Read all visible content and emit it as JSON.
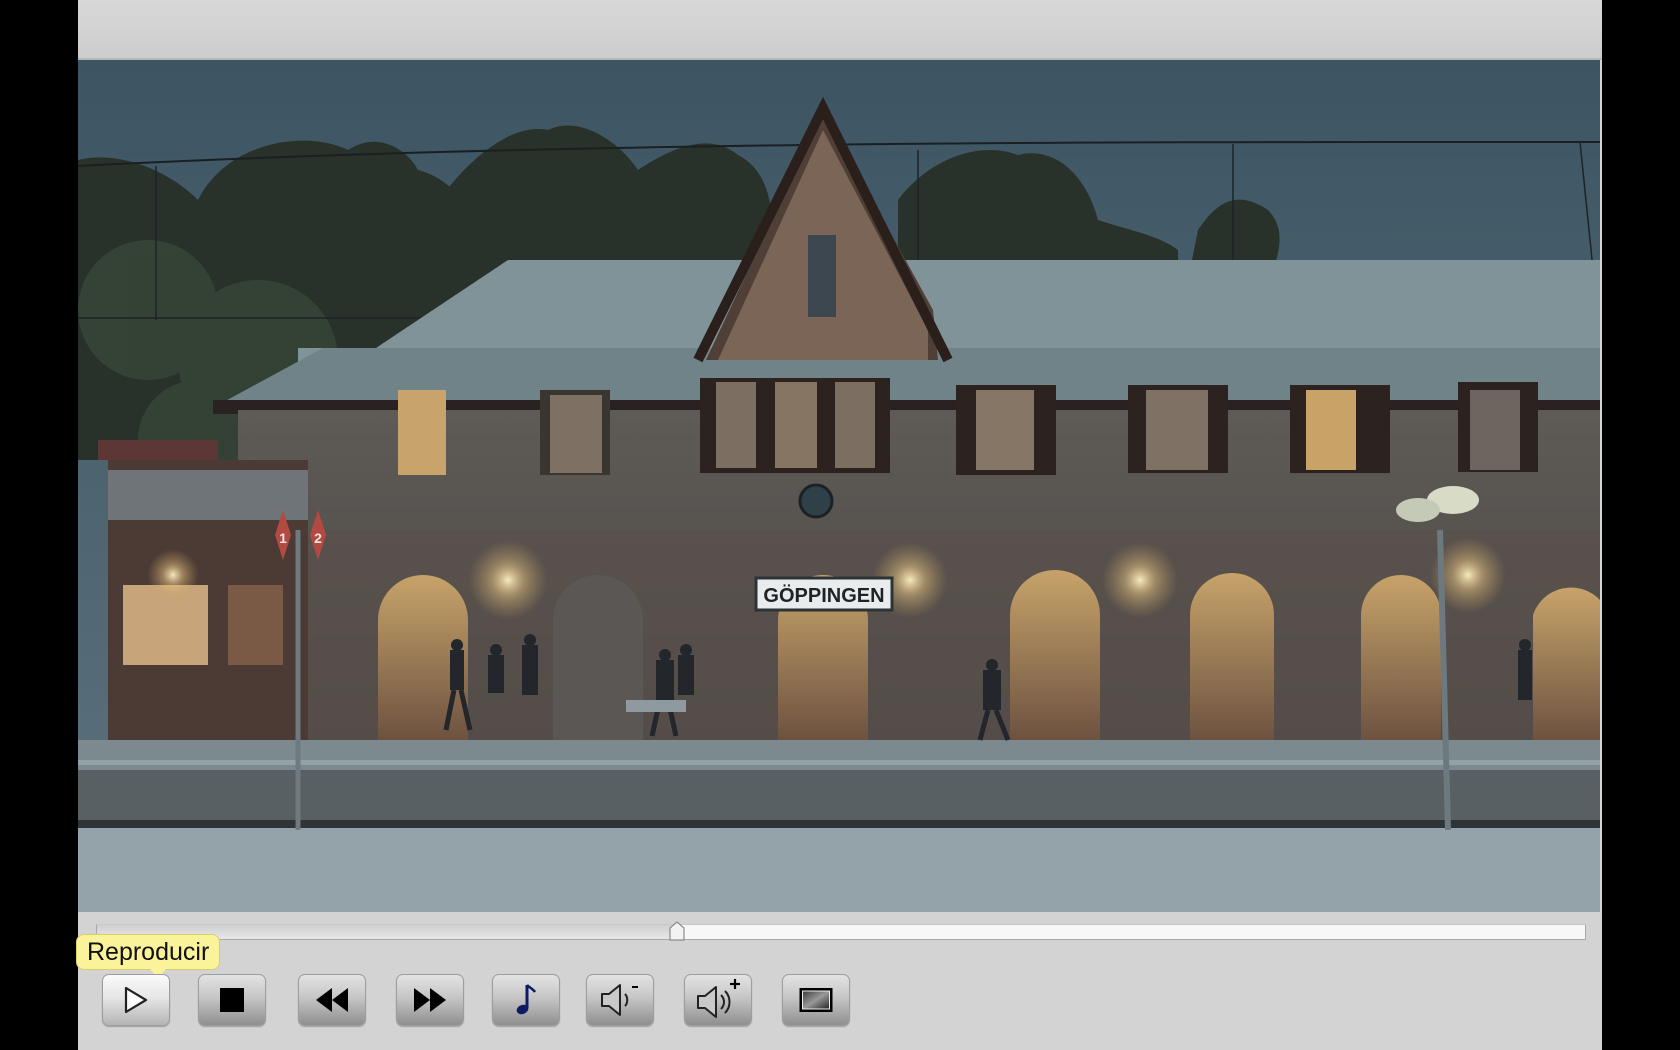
{
  "video": {
    "station_sign": "GÖPPINGEN",
    "platform_signs": [
      "1",
      "2"
    ]
  },
  "player": {
    "progress": 0.39,
    "tooltip": "Reproducir",
    "controls": [
      {
        "name": "play-button",
        "icon": "play-icon"
      },
      {
        "name": "stop-button",
        "icon": "stop-icon"
      },
      {
        "name": "rewind-button",
        "icon": "rewind-icon"
      },
      {
        "name": "fast-forward-button",
        "icon": "fast-forward-icon"
      },
      {
        "name": "audio-track-button",
        "icon": "music-note-icon"
      },
      {
        "name": "volume-down-button",
        "icon": "volume-down-icon"
      },
      {
        "name": "volume-up-button",
        "icon": "volume-up-icon"
      },
      {
        "name": "fullscreen-button",
        "icon": "fullscreen-icon"
      }
    ]
  }
}
